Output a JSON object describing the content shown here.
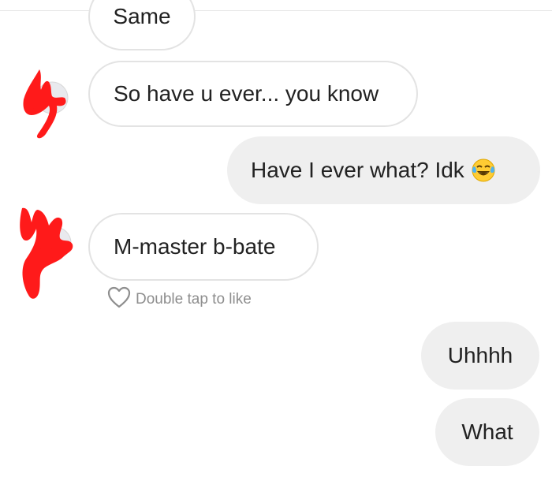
{
  "messages": [
    {
      "id": "m0",
      "direction": "received",
      "text": "Same"
    },
    {
      "id": "m1",
      "direction": "received",
      "text": "So have u ever... you know"
    },
    {
      "id": "m2",
      "direction": "sent",
      "text": "Have I ever what? Idk",
      "emoji": "tears-of-joy-emoji"
    },
    {
      "id": "m3",
      "direction": "received",
      "text": "M-master b-bate"
    },
    {
      "id": "m4",
      "direction": "sent",
      "text": "Uhhhh"
    },
    {
      "id": "m5",
      "direction": "sent",
      "text": "What"
    }
  ],
  "like_hint": {
    "icon": "heart-outline-icon",
    "text": "Double tap to like"
  },
  "colors": {
    "sent_bubble": "#efefef",
    "received_border": "#e3e3e3",
    "redaction": "#ff1a1a",
    "hint_text": "#8e8e8e"
  }
}
